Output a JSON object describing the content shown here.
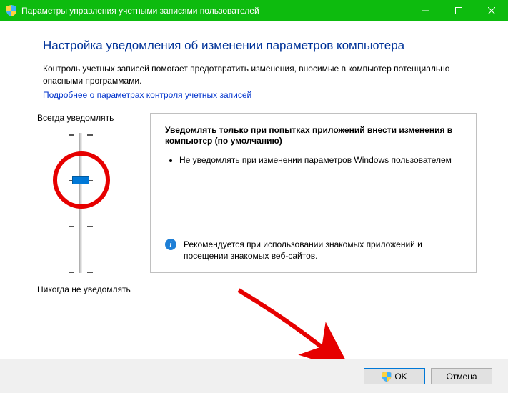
{
  "window": {
    "title": "Параметры управления учетными записями пользователей"
  },
  "main": {
    "heading": "Настройка уведомления об изменении параметров компьютера",
    "description": "Контроль учетных записей помогает предотвратить изменения, вносимые в компьютер потенциально опасными программами.",
    "link": "Подробнее о параметрах контроля учетных записей"
  },
  "slider": {
    "top_label": "Всегда уведомлять",
    "bottom_label": "Никогда не уведомлять",
    "levels": 4,
    "selected_level": 2
  },
  "info": {
    "title": "Уведомлять только при попытках приложений внести изменения в компьютер (по умолчанию)",
    "bullet1": "Не уведомлять при изменении параметров Windows пользователем",
    "recommendation": "Рекомендуется при использовании знакомых приложений и посещении знакомых веб-сайтов."
  },
  "buttons": {
    "ok": "OK",
    "cancel": "Отмена"
  }
}
